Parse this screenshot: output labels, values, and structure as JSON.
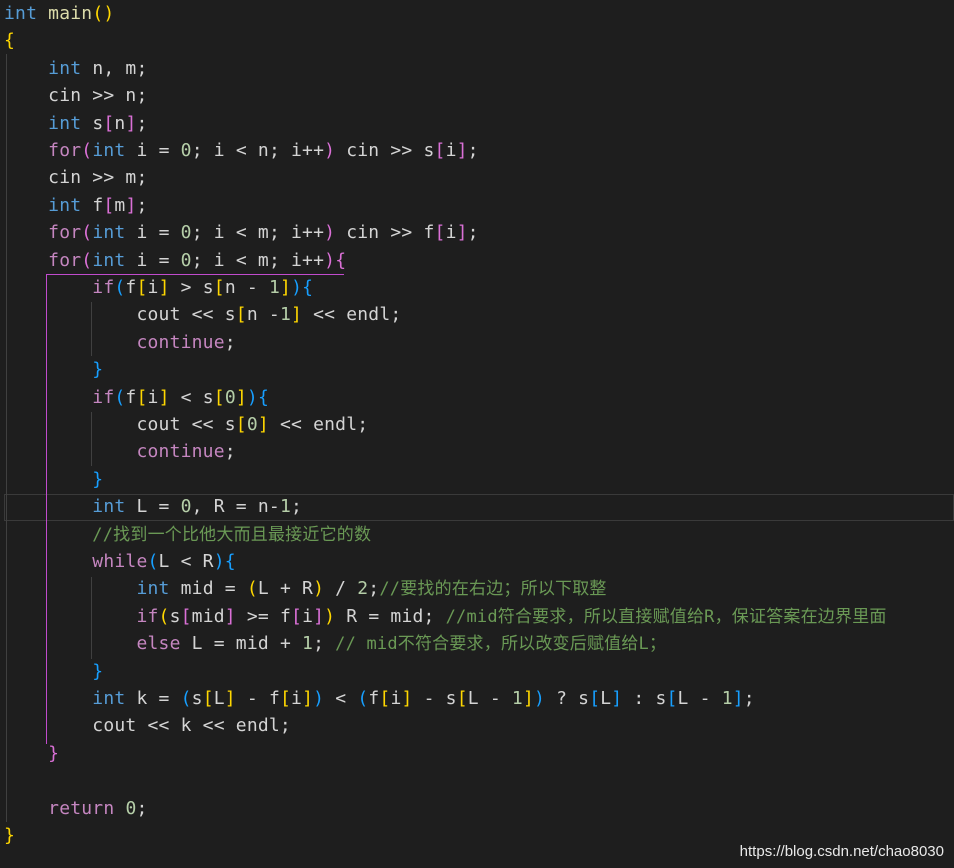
{
  "colors": {
    "background": "#1e1e1e",
    "plain": "#d4d4d4",
    "keyword_type": "#569cd6",
    "control": "#c586c0",
    "function": "#dcdcaa",
    "number": "#b5cea8",
    "comment": "#6a9955",
    "bracket1": "#ffd700",
    "bracket2": "#da70d6",
    "bracket3": "#179fff",
    "guide_active": "#c14bcd"
  },
  "watermark": "https://blog.csdn.net/chao8030",
  "lines": [
    [
      [
        "int",
        "kw"
      ],
      [
        " ",
        ""
      ],
      [
        "main",
        "fn"
      ],
      [
        "()",
        "b1"
      ]
    ],
    [
      [
        "{",
        "b1"
      ]
    ],
    [
      [
        "    ",
        ""
      ],
      [
        "int",
        "kw"
      ],
      [
        " n, m;",
        ""
      ]
    ],
    [
      [
        "    ",
        ""
      ],
      [
        "cin >> n;",
        ""
      ]
    ],
    [
      [
        "    ",
        ""
      ],
      [
        "int",
        "kw"
      ],
      [
        " s",
        ""
      ],
      [
        "[",
        "b2"
      ],
      [
        "n",
        ""
      ],
      [
        "]",
        "b2"
      ],
      [
        ";",
        ""
      ]
    ],
    [
      [
        "    ",
        ""
      ],
      [
        "for",
        "ctl"
      ],
      [
        "(",
        "b2"
      ],
      [
        "int",
        "kw"
      ],
      [
        " i = ",
        ""
      ],
      [
        "0",
        "num"
      ],
      [
        "; i < n; i++",
        ""
      ],
      [
        ")",
        "b2"
      ],
      [
        " cin >> s",
        ""
      ],
      [
        "[",
        "b2"
      ],
      [
        "i",
        ""
      ],
      [
        "]",
        "b2"
      ],
      [
        ";",
        ""
      ]
    ],
    [
      [
        "    ",
        ""
      ],
      [
        "cin >> m;",
        ""
      ]
    ],
    [
      [
        "    ",
        ""
      ],
      [
        "int",
        "kw"
      ],
      [
        " f",
        ""
      ],
      [
        "[",
        "b2"
      ],
      [
        "m",
        ""
      ],
      [
        "]",
        "b2"
      ],
      [
        ";",
        ""
      ]
    ],
    [
      [
        "    ",
        ""
      ],
      [
        "for",
        "ctl"
      ],
      [
        "(",
        "b2"
      ],
      [
        "int",
        "kw"
      ],
      [
        " i = ",
        ""
      ],
      [
        "0",
        "num"
      ],
      [
        "; i < m; i++",
        ""
      ],
      [
        ")",
        "b2"
      ],
      [
        " cin >> f",
        ""
      ],
      [
        "[",
        "b2"
      ],
      [
        "i",
        ""
      ],
      [
        "]",
        "b2"
      ],
      [
        ";",
        ""
      ]
    ],
    [
      [
        "    ",
        ""
      ],
      [
        "for",
        "ctl"
      ],
      [
        "(",
        "b2"
      ],
      [
        "int",
        "kw"
      ],
      [
        " i = ",
        ""
      ],
      [
        "0",
        "num"
      ],
      [
        "; i < m; i++",
        ""
      ],
      [
        ")",
        "b2"
      ],
      [
        "{",
        "b2"
      ]
    ],
    [
      [
        "        ",
        ""
      ],
      [
        "if",
        "ctl"
      ],
      [
        "(",
        "b3"
      ],
      [
        "f",
        ""
      ],
      [
        "[",
        "b1"
      ],
      [
        "i",
        ""
      ],
      [
        "]",
        "b1"
      ],
      [
        " > s",
        ""
      ],
      [
        "[",
        "b1"
      ],
      [
        "n - ",
        ""
      ],
      [
        "1",
        "num"
      ],
      [
        "]",
        "b1"
      ],
      [
        ")",
        "b3"
      ],
      [
        "{",
        "b3"
      ]
    ],
    [
      [
        "            ",
        ""
      ],
      [
        "cout << s",
        ""
      ],
      [
        "[",
        "b1"
      ],
      [
        "n -",
        ""
      ],
      [
        "1",
        "num"
      ],
      [
        "]",
        "b1"
      ],
      [
        " << endl;",
        ""
      ]
    ],
    [
      [
        "            ",
        ""
      ],
      [
        "continue",
        "ctl"
      ],
      [
        ";",
        ""
      ]
    ],
    [
      [
        "        ",
        ""
      ],
      [
        "}",
        "b3"
      ]
    ],
    [
      [
        "        ",
        ""
      ],
      [
        "if",
        "ctl"
      ],
      [
        "(",
        "b3"
      ],
      [
        "f",
        ""
      ],
      [
        "[",
        "b1"
      ],
      [
        "i",
        ""
      ],
      [
        "]",
        "b1"
      ],
      [
        " < s",
        ""
      ],
      [
        "[",
        "b1"
      ],
      [
        "0",
        "num"
      ],
      [
        "]",
        "b1"
      ],
      [
        ")",
        "b3"
      ],
      [
        "{",
        "b3"
      ]
    ],
    [
      [
        "            ",
        ""
      ],
      [
        "cout << s",
        ""
      ],
      [
        "[",
        "b1"
      ],
      [
        "0",
        "num"
      ],
      [
        "]",
        "b1"
      ],
      [
        " << endl;",
        ""
      ]
    ],
    [
      [
        "            ",
        ""
      ],
      [
        "continue",
        "ctl"
      ],
      [
        ";",
        ""
      ]
    ],
    [
      [
        "        ",
        ""
      ],
      [
        "}",
        "b3"
      ]
    ],
    [
      [
        "        ",
        ""
      ],
      [
        "int",
        "kw"
      ],
      [
        " L = ",
        ""
      ],
      [
        "0",
        "num"
      ],
      [
        ", R = n-",
        ""
      ],
      [
        "1",
        "num"
      ],
      [
        ";",
        ""
      ]
    ],
    [
      [
        "        ",
        ""
      ],
      [
        "//找到一个比他大而且最接近它的数",
        "cm"
      ]
    ],
    [
      [
        "        ",
        ""
      ],
      [
        "while",
        "ctl"
      ],
      [
        "(",
        "b3"
      ],
      [
        "L < R",
        ""
      ],
      [
        ")",
        "b3"
      ],
      [
        "{",
        "b3"
      ]
    ],
    [
      [
        "            ",
        ""
      ],
      [
        "int",
        "kw"
      ],
      [
        " mid = ",
        ""
      ],
      [
        "(",
        "b1"
      ],
      [
        "L + R",
        ""
      ],
      [
        ")",
        "b1"
      ],
      [
        " / ",
        ""
      ],
      [
        "2",
        "num"
      ],
      [
        ";",
        ""
      ],
      [
        "//要找的在右边；所以下取整",
        "cm"
      ]
    ],
    [
      [
        "            ",
        ""
      ],
      [
        "if",
        "ctl"
      ],
      [
        "(",
        "b1"
      ],
      [
        "s",
        ""
      ],
      [
        "[",
        "b2"
      ],
      [
        "mid",
        ""
      ],
      [
        "]",
        "b2"
      ],
      [
        " >= f",
        ""
      ],
      [
        "[",
        "b2"
      ],
      [
        "i",
        ""
      ],
      [
        "]",
        "b2"
      ],
      [
        ")",
        "b1"
      ],
      [
        " R = mid; ",
        ""
      ],
      [
        "//mid符合要求，所以直接赋值给R，保证答案在边界里面",
        "cm"
      ]
    ],
    [
      [
        "            ",
        ""
      ],
      [
        "else",
        "ctl"
      ],
      [
        " L = mid + ",
        ""
      ],
      [
        "1",
        "num"
      ],
      [
        "; ",
        ""
      ],
      [
        "// mid不符合要求，所以改变后赋值给L；",
        "cm"
      ]
    ],
    [
      [
        "        ",
        ""
      ],
      [
        "}",
        "b3"
      ]
    ],
    [
      [
        "        ",
        ""
      ],
      [
        "int",
        "kw"
      ],
      [
        " k = ",
        ""
      ],
      [
        "(",
        "b3"
      ],
      [
        "s",
        ""
      ],
      [
        "[",
        "b1"
      ],
      [
        "L",
        ""
      ],
      [
        "]",
        "b1"
      ],
      [
        " - f",
        ""
      ],
      [
        "[",
        "b1"
      ],
      [
        "i",
        ""
      ],
      [
        "]",
        "b1"
      ],
      [
        ")",
        "b3"
      ],
      [
        " < ",
        ""
      ],
      [
        "(",
        "b3"
      ],
      [
        "f",
        ""
      ],
      [
        "[",
        "b1"
      ],
      [
        "i",
        ""
      ],
      [
        "]",
        "b1"
      ],
      [
        " - s",
        ""
      ],
      [
        "[",
        "b1"
      ],
      [
        "L - ",
        ""
      ],
      [
        "1",
        "num"
      ],
      [
        "]",
        "b1"
      ],
      [
        ")",
        "b3"
      ],
      [
        " ? s",
        ""
      ],
      [
        "[",
        "b3"
      ],
      [
        "L",
        ""
      ],
      [
        "]",
        "b3"
      ],
      [
        " : s",
        ""
      ],
      [
        "[",
        "b3"
      ],
      [
        "L - ",
        ""
      ],
      [
        "1",
        "num"
      ],
      [
        "]",
        "b3"
      ],
      [
        ";",
        ""
      ]
    ],
    [
      [
        "        ",
        ""
      ],
      [
        "cout << k << endl;",
        ""
      ]
    ],
    [
      [
        "    ",
        ""
      ],
      [
        "}",
        "b2"
      ]
    ],
    [],
    [
      [
        "    ",
        ""
      ],
      [
        "return",
        "ctl"
      ],
      [
        " ",
        ""
      ],
      [
        "0",
        "num"
      ],
      [
        ";",
        ""
      ]
    ],
    [
      [
        "}",
        "b1"
      ]
    ]
  ]
}
